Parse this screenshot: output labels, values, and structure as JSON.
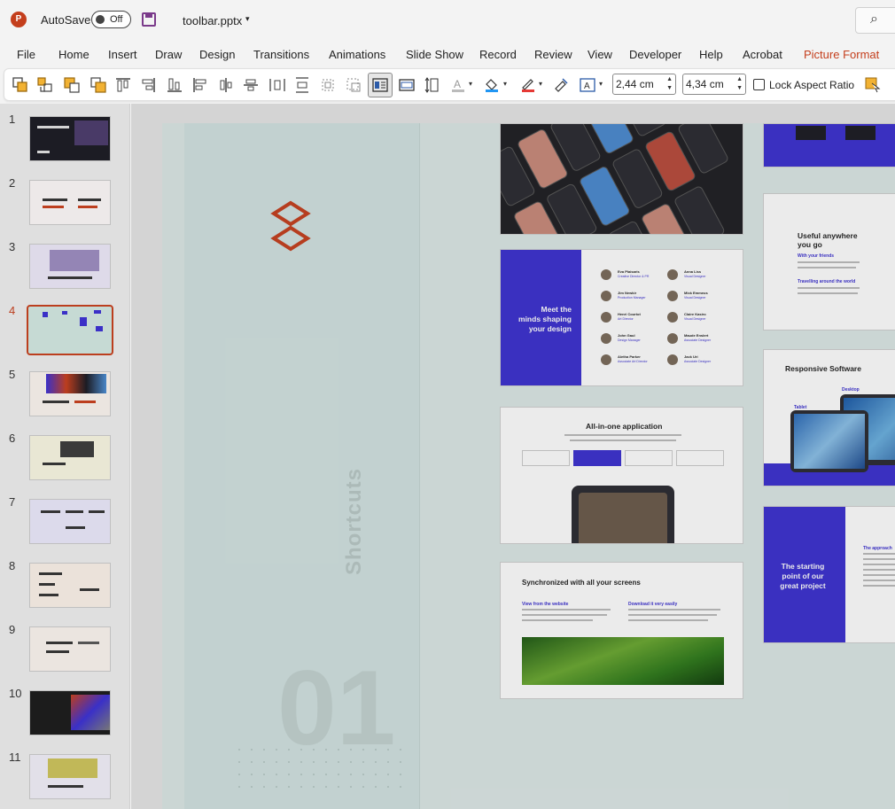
{
  "titlebar": {
    "app_icon": "P",
    "autosave_label": "AutoSave",
    "autosave_state": "Off",
    "filename": "toolbar.pptx"
  },
  "menu": [
    "File",
    "Home",
    "Insert",
    "Draw",
    "Design",
    "Transitions",
    "Animations",
    "Slide Show",
    "Record",
    "Review",
    "View",
    "Developer",
    "Help",
    "Acrobat",
    "Picture Format"
  ],
  "toolbar": {
    "height_value": "2,44 cm",
    "width_value": "4,34 cm",
    "lock_aspect_label": "Lock Aspect Ratio",
    "icons": [
      "bring-forward-icon",
      "send-backward-icon",
      "group-icon",
      "ungroup-icon",
      "align-top-icon",
      "align-right-icon",
      "align-bottom-icon",
      "align-left-icon",
      "align-center-icon",
      "distribute-horizontal-icon",
      "align-middle-icon",
      "crop-icon",
      "crop-to-shape-icon",
      "wrap-text-icon",
      "text-box-icon",
      "line-spacing-icon",
      "font-color-icon",
      "fill-color-icon",
      "outline-color-icon",
      "format-painter-icon",
      "text-autofit-icon",
      "selection-pane-icon"
    ]
  },
  "thumbnails": {
    "numbers": [
      "1",
      "2",
      "3",
      "4",
      "5",
      "6",
      "7",
      "8",
      "9",
      "10",
      "11"
    ],
    "current_index": 4
  },
  "slide": {
    "vertical_label": "Shortcuts",
    "big_number": "01",
    "cards": {
      "meet_title": "Meet the\nminds shaping\nyour design",
      "people": [
        {
          "name": "Eva Plaisaris",
          "role": "Creative Director & PR"
        },
        {
          "name": "Anna Liss",
          "role": "Visual Designer"
        },
        {
          "name": "Jim Newkir",
          "role": "Production Manager"
        },
        {
          "name": "Mick Emmeus",
          "role": "Visual Designer"
        },
        {
          "name": "Henri Courtot",
          "role": "Art Director"
        },
        {
          "name": "Claire Kasiro",
          "role": "Visual Designer"
        },
        {
          "name": "John Gaul",
          "role": "Design Manager"
        },
        {
          "name": "Maude Enslert",
          "role": "Associate Designer"
        },
        {
          "name": "Aletha Parker",
          "role": "Associate Art Director"
        },
        {
          "name": "Jack Uri",
          "role": "Associate Designer"
        }
      ],
      "allinone_title": "All-in-one application",
      "sync_title": "Synchronized with all your screens",
      "sync_sub1": "View from the website",
      "sync_sub2": "Download it very easily",
      "useful_title": "Useful anywhere\nyou go",
      "useful_sub1": "With your friends",
      "useful_sub2": "Travelling around the world",
      "responsive_title": "Responsive Software",
      "responsive_label1": "Tablet",
      "responsive_label2": "Desktop",
      "starting_title": "The starting\npoint of our\ngreat project",
      "starting_sub": "The approach"
    }
  },
  "colors": {
    "brand": "#c43e1c",
    "accent_purple": "#3a2fd0",
    "slide_bg": "#dce8e6"
  }
}
